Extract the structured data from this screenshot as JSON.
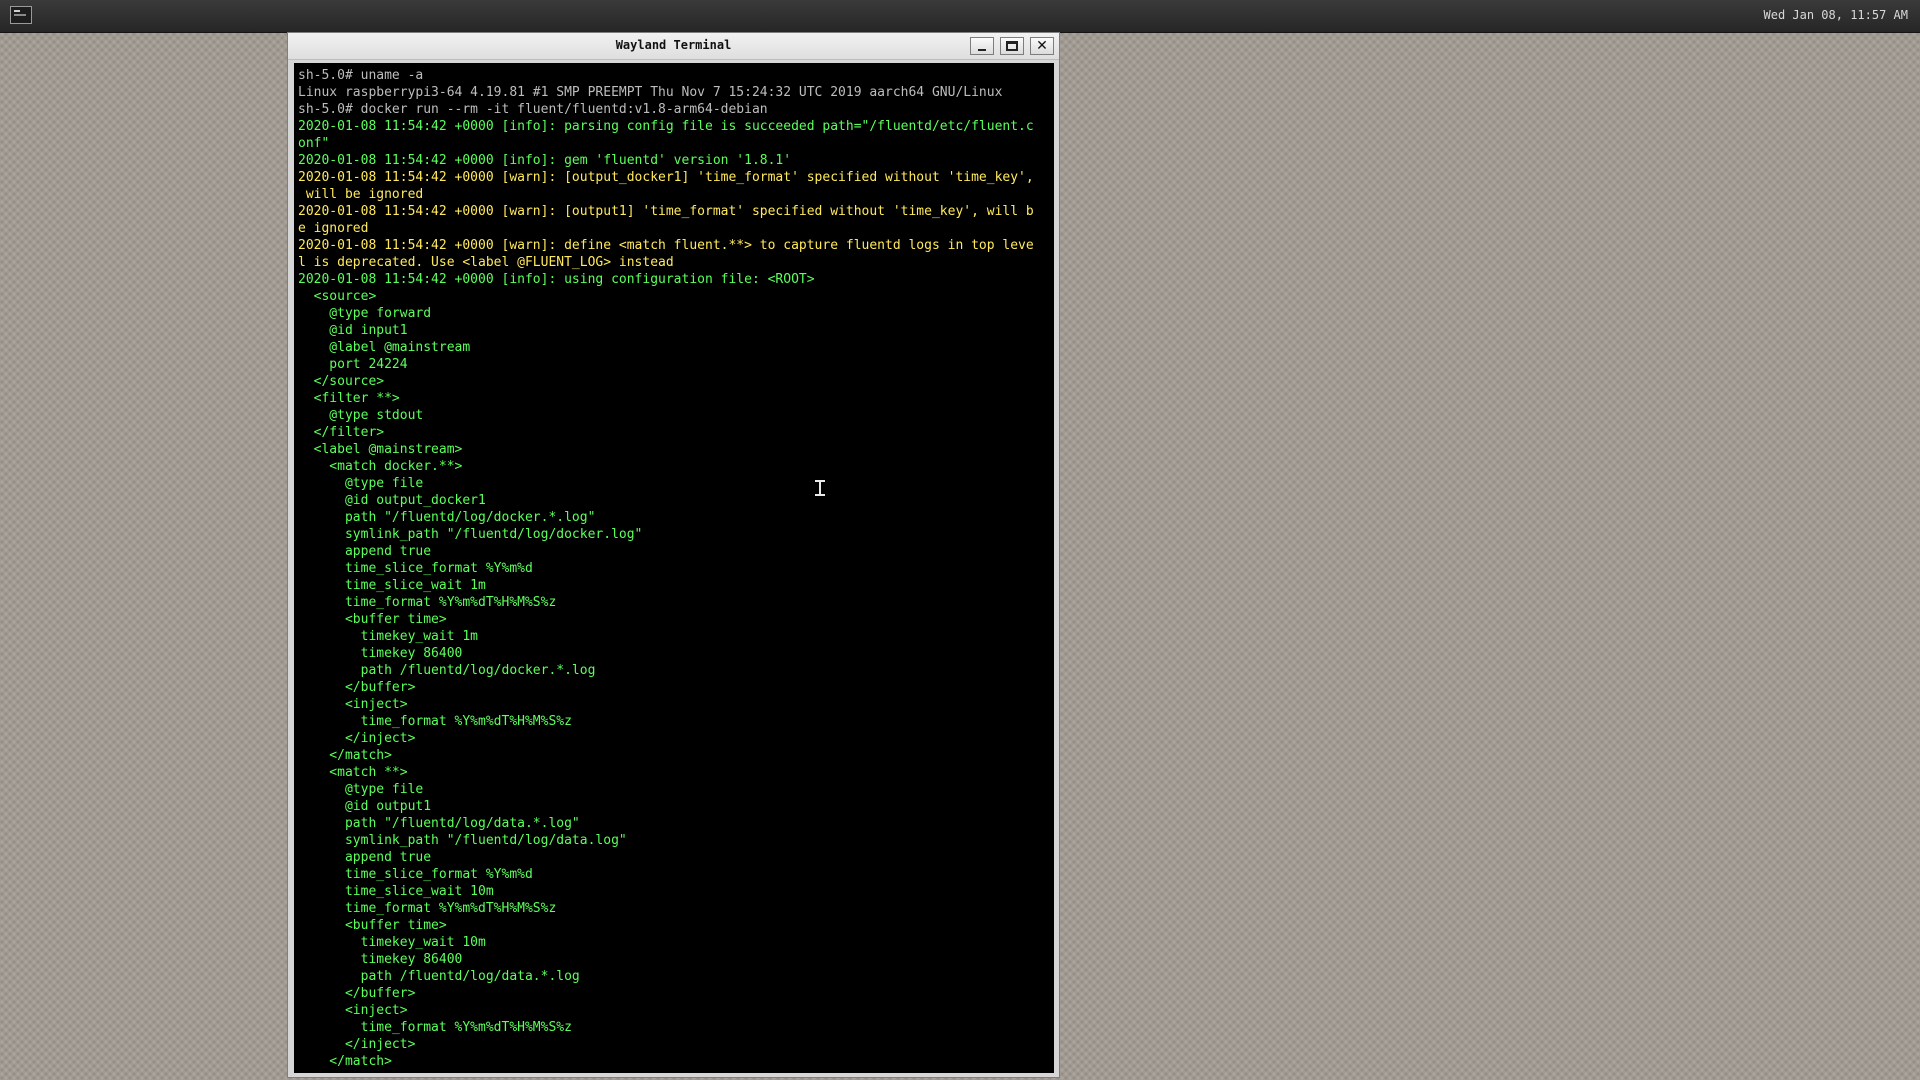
{
  "panel": {
    "launcher_icon": "terminal-icon",
    "clock": "Wed Jan 08, 11:57 AM"
  },
  "window": {
    "title": "Wayland Terminal",
    "buttons": {
      "minimize": "minimize-icon",
      "maximize": "maximize-icon",
      "close": "✕"
    }
  },
  "terminal": {
    "colors": {
      "background": "#000000",
      "prompt": "#bdbdbd",
      "info": "#5cff5c",
      "warn": "#ffe95c"
    },
    "lines": [
      "sh-5.0# uname -a",
      "Linux raspberrypi3-64 4.19.81 #1 SMP PREEMPT Thu Nov 7 15:24:32 UTC 2019 aarch64 GNU/Linux",
      "sh-5.0# docker run --rm -it fluent/fluentd:v1.8-arm64-debian",
      "2020-01-08 11:54:42 +0000 [info]: parsing config file is succeeded path=\"/fluentd/etc/fluent.c",
      "onf\"",
      "2020-01-08 11:54:42 +0000 [info]: gem 'fluentd' version '1.8.1'",
      "2020-01-08 11:54:42 +0000 [warn]: [output_docker1] 'time_format' specified without 'time_key',",
      " will be ignored",
      "2020-01-08 11:54:42 +0000 [warn]: [output1] 'time_format' specified without 'time_key', will b",
      "e ignored",
      "2020-01-08 11:54:42 +0000 [warn]: define <match fluent.**> to capture fluentd logs in top leve",
      "l is deprecated. Use <label @FLUENT_LOG> instead",
      "2020-01-08 11:54:42 +0000 [info]: using configuration file: <ROOT>",
      "  <source>",
      "    @type forward",
      "    @id input1",
      "    @label @mainstream",
      "    port 24224",
      "  </source>",
      "  <filter **>",
      "    @type stdout",
      "  </filter>",
      "  <label @mainstream>",
      "    <match docker.**>",
      "      @type file",
      "      @id output_docker1",
      "      path \"/fluentd/log/docker.*.log\"",
      "      symlink_path \"/fluentd/log/docker.log\"",
      "      append true",
      "      time_slice_format %Y%m%d",
      "      time_slice_wait 1m",
      "      time_format %Y%m%dT%H%M%S%z",
      "      <buffer time>",
      "        timekey_wait 1m",
      "        timekey 86400",
      "        path /fluentd/log/docker.*.log",
      "      </buffer>",
      "      <inject>",
      "        time_format %Y%m%dT%H%M%S%z",
      "      </inject>",
      "    </match>",
      "    <match **>",
      "      @type file",
      "      @id output1",
      "      path \"/fluentd/log/data.*.log\"",
      "      symlink_path \"/fluentd/log/data.log\"",
      "      append true",
      "      time_slice_format %Y%m%d",
      "      time_slice_wait 10m",
      "      time_format %Y%m%dT%H%M%S%z",
      "      <buffer time>",
      "        timekey_wait 10m",
      "        timekey 86400",
      "        path /fluentd/log/data.*.log",
      "      </buffer>",
      "      <inject>",
      "        time_format %Y%m%dT%H%M%S%z",
      "      </inject>",
      "    </match>"
    ]
  }
}
